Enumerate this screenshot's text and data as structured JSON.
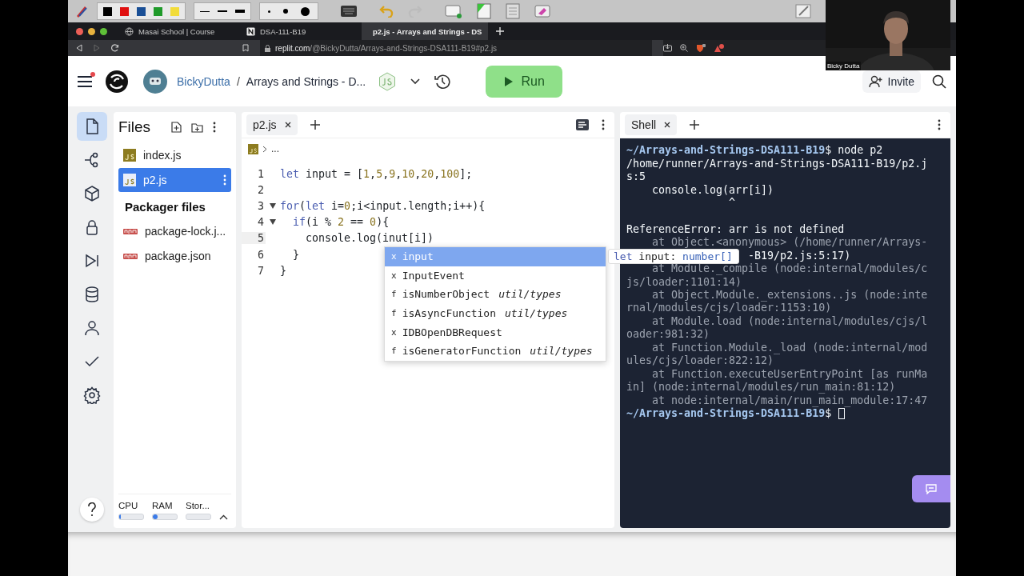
{
  "annotation_toolbar": {
    "swatches": [
      {
        "color": "#000000"
      },
      {
        "color": "#e01010"
      },
      {
        "color": "#1a4f96"
      },
      {
        "color": "#1f9a2a"
      },
      {
        "color": "#f2dc3a"
      }
    ],
    "redo_disabled": true
  },
  "browser": {
    "tabs": [
      {
        "title": "Masai School | Course",
        "selected": false
      },
      {
        "title": "DSA-111-B19",
        "selected": false
      },
      {
        "title": "p2.js - Arrays and Strings - DS",
        "selected": true
      }
    ],
    "address": {
      "domain": "replit.com",
      "path": "/@BickyDutta/Arrays-and-Strings-DSA111-B19#p2.js"
    },
    "forward_disabled": true
  },
  "webcam": {
    "kind": "picture",
    "name": "Bicky Dutta"
  },
  "header": {
    "menu_badge": true,
    "owner": "BickyDutta",
    "separator": "/",
    "repl": "Arrays and Strings - D...",
    "run_label": "Run",
    "invite_label": "Invite"
  },
  "rail": [
    {
      "selected": true
    },
    {
      "selected": false
    },
    {
      "selected": false
    },
    {
      "selected": false
    },
    {
      "selected": false
    },
    {
      "selected": false
    },
    {
      "selected": false
    },
    {
      "selected": false
    },
    {
      "selected": false
    }
  ],
  "files": {
    "title": "Files",
    "items": [
      {
        "name": "index.js",
        "kind": "js",
        "selected": false
      },
      {
        "name": "p2.js",
        "kind": "js",
        "selected": true
      }
    ],
    "packager_title": "Packager files",
    "packager_items": [
      {
        "name": "package-lock.j...",
        "kind": "npm",
        "selected": false
      },
      {
        "name": "package.json",
        "kind": "npm",
        "selected": false
      }
    ]
  },
  "resources": [
    {
      "label": "CPU",
      "level": 0.03
    },
    {
      "label": "RAM",
      "level": 0.2
    },
    {
      "label": "Stor..."
    }
  ],
  "editor": {
    "tab": "p2.js",
    "breadcrumb": "...",
    "lines": [
      {
        "number": "1",
        "tokens": [
          {
            "text": "let",
            "kind": "keyword"
          },
          {
            "text": " input = [",
            "kind": "plain"
          },
          {
            "text": "1",
            "kind": "number"
          },
          {
            "text": ",",
            "kind": "plain"
          },
          {
            "text": "5",
            "kind": "number"
          },
          {
            "text": ",",
            "kind": "plain"
          },
          {
            "text": "9",
            "kind": "number"
          },
          {
            "text": ",",
            "kind": "plain"
          },
          {
            "text": "10",
            "kind": "number"
          },
          {
            "text": ",",
            "kind": "plain"
          },
          {
            "text": "20",
            "kind": "number"
          },
          {
            "text": ",",
            "kind": "plain"
          },
          {
            "text": "100",
            "kind": "number"
          },
          {
            "text": "];",
            "kind": "plain"
          }
        ]
      },
      {
        "number": "2"
      },
      {
        "number": "3",
        "foldable": true,
        "tokens": [
          {
            "text": "for",
            "kind": "keyword"
          },
          {
            "text": "(",
            "kind": "plain"
          },
          {
            "text": "let",
            "kind": "keyword"
          },
          {
            "text": " i=",
            "kind": "plain"
          },
          {
            "text": "0",
            "kind": "number"
          },
          {
            "text": ";i<input.length;i++){",
            "kind": "plain"
          }
        ]
      },
      {
        "number": "4",
        "foldable": true,
        "tokens": [
          {
            "text": "  if",
            "kind": "keyword"
          },
          {
            "text": "(i % ",
            "kind": "plain"
          },
          {
            "text": "2",
            "kind": "number"
          },
          {
            "text": " == ",
            "kind": "plain"
          },
          {
            "text": "0",
            "kind": "number"
          },
          {
            "text": "){",
            "kind": "plain"
          }
        ]
      },
      {
        "number": "5",
        "current": true,
        "tokens": [
          {
            "text": "    console.log(inut[i])",
            "kind": "plain"
          }
        ]
      },
      {
        "number": "6",
        "tokens": [
          {
            "text": "  }",
            "kind": "plain"
          }
        ]
      },
      {
        "number": "7",
        "tokens": [
          {
            "text": "}",
            "kind": "plain"
          }
        ]
      }
    ],
    "completions": [
      {
        "icon": "x",
        "label": "input",
        "selected": true
      },
      {
        "icon": "x",
        "label": "InputEvent",
        "selected": false
      },
      {
        "icon": "f",
        "label": "isNumberObject",
        "detail": "util/types",
        "selected": false
      },
      {
        "icon": "f",
        "label": "isAsyncFunction",
        "detail": "util/types",
        "selected": false
      },
      {
        "icon": "x",
        "label": "IDBOpenDBRequest",
        "selected": false
      },
      {
        "icon": "f",
        "label": "isGeneratorFunction",
        "detail": "util/types",
        "selected": false
      }
    ],
    "hover": {
      "keyword": "let",
      "name": "input:",
      "type": "number[]"
    }
  },
  "shell": {
    "tab": "Shell",
    "lines": [
      {
        "kind": "prompt",
        "path": "~/Arrays-and-Strings-DSA111-B19",
        "text": "$ node p2"
      },
      {
        "kind": "text",
        "text": "/home/runner/Arrays-and-Strings-DSA111-B19/p2.j"
      },
      {
        "kind": "text",
        "text": "s:5"
      },
      {
        "kind": "text",
        "text": "    console.log(arr[i])"
      },
      {
        "kind": "text",
        "text": "                ^"
      },
      {
        "kind": "blank"
      },
      {
        "kind": "text",
        "text": "ReferenceError: arr is not defined"
      },
      {
        "kind": "dim",
        "text": "    at Object.<anonymous> (/home/runner/Arrays-"
      },
      {
        "kind": "covered",
        "text": "-B19/p2.js:5:17)"
      },
      {
        "kind": "dim",
        "text": "    at Module._compile (node:internal/modules/c"
      },
      {
        "kind": "dim",
        "text": "js/loader:1101:14)"
      },
      {
        "kind": "dim",
        "text": "    at Object.Module._extensions..js (node:inte"
      },
      {
        "kind": "dim",
        "text": "rnal/modules/cjs/loader:1153:10)"
      },
      {
        "kind": "dim",
        "text": "    at Module.load (node:internal/modules/cjs/l"
      },
      {
        "kind": "dim",
        "text": "oader:981:32)"
      },
      {
        "kind": "dim",
        "text": "    at Function.Module._load (node:internal/mod"
      },
      {
        "kind": "dim",
        "text": "ules/cjs/loader:822:12)"
      },
      {
        "kind": "dim",
        "text": "    at Function.executeUserEntryPoint [as runMa"
      },
      {
        "kind": "dim",
        "text": "in] (node:internal/modules/run_main:81:12)"
      },
      {
        "kind": "dim",
        "text": "    at node:internal/main/run_main_module:17:47"
      },
      {
        "kind": "prompt",
        "path": "~/Arrays-and-Strings-DSA111-B19",
        "text": "$ ",
        "cursor": true
      }
    ]
  }
}
